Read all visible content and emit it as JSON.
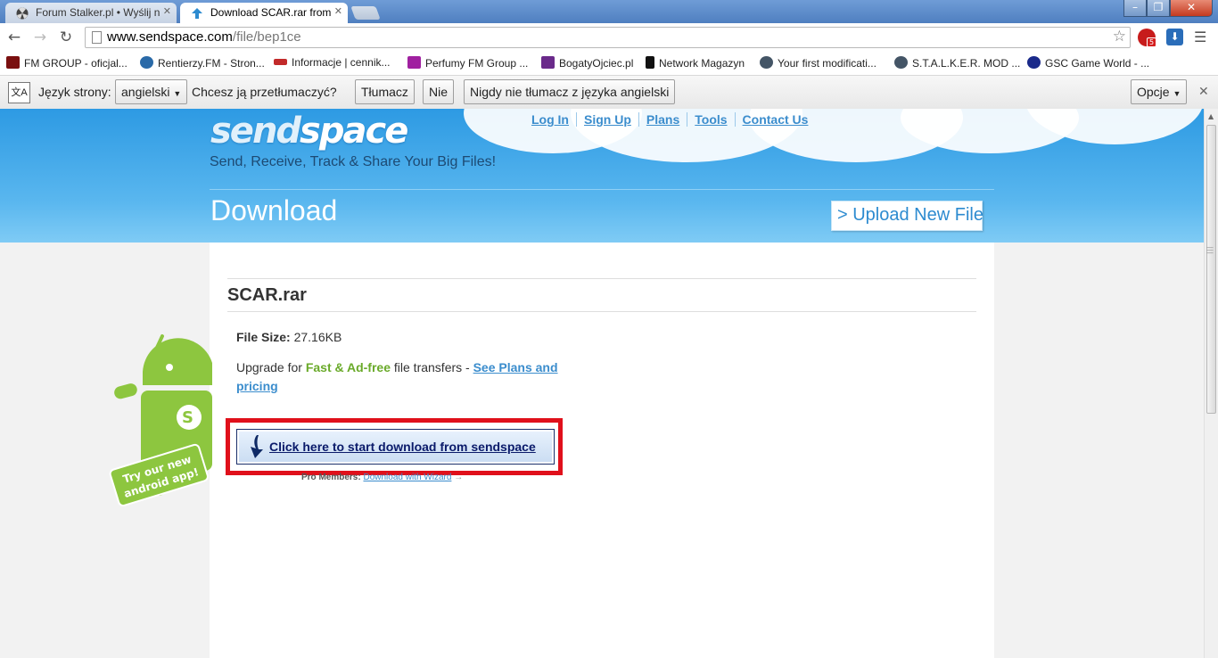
{
  "tabs": [
    {
      "label": "Forum Stalker.pl • Wyślij n",
      "active": false
    },
    {
      "label": "Download SCAR.rar from ",
      "active": true
    }
  ],
  "address": {
    "domain": "www.sendspace.com",
    "path": "/file/bep1ce"
  },
  "extension_badge": "5",
  "bookmarks": [
    {
      "label": "FM GROUP - oficjal...",
      "color": "#7a1010"
    },
    {
      "label": "Rentierzy.FM - Stron...",
      "color": "#2a6aa8"
    },
    {
      "label": "Informacje | cennik...",
      "color": "#c22a2a"
    },
    {
      "label": "Perfumy FM Group ...",
      "color": "#a020a0"
    },
    {
      "label": "BogatyOjciec.pl",
      "color": "#6a2a8a"
    },
    {
      "label": "Network Magazyn",
      "color": "#111111"
    },
    {
      "label": "Your first modificati...",
      "color": "#445566"
    },
    {
      "label": "S.T.A.L.K.E.R. MOD ...",
      "color": "#445566"
    },
    {
      "label": "GSC Game World - ...",
      "color": "#1a2a8a"
    }
  ],
  "translate_bar": {
    "page_lang_label": "Język strony:",
    "lang_value": "angielski",
    "question": "Chcesz ją przetłumaczyć?",
    "translate_btn": "Tłumacz",
    "no_btn": "Nie",
    "never_btn": "Nigdy nie tłumacz z języka angielski",
    "options_btn": "Opcje"
  },
  "site": {
    "logo_a": "send",
    "logo_b": "space",
    "tagline": "Send, Receive, Track & Share Your Big Files!",
    "nav": [
      "Log In",
      "Sign Up",
      "Plans",
      "Tools",
      "Contact Us"
    ],
    "section_title": "Download",
    "upload_btn": "> Upload New File"
  },
  "file": {
    "name": "SCAR.rar",
    "size_label": "File Size:",
    "size_value": "27.16KB",
    "upgrade_pre": "Upgrade for ",
    "upgrade_highlight": "Fast & Ad-free",
    "upgrade_mid": " file transfers - ",
    "upgrade_link": "See Plans and pricing",
    "download_btn": "Click here to start download from sendspace",
    "pro_label": "Pro Members:",
    "pro_link": "Download with Wizard"
  },
  "android_promo": {
    "line1": "Try our new",
    "line2": "android app!"
  },
  "colors": {
    "accent_blue": "#3b8dcd",
    "highlight_red": "#e0101b",
    "green": "#6aaa2a"
  }
}
